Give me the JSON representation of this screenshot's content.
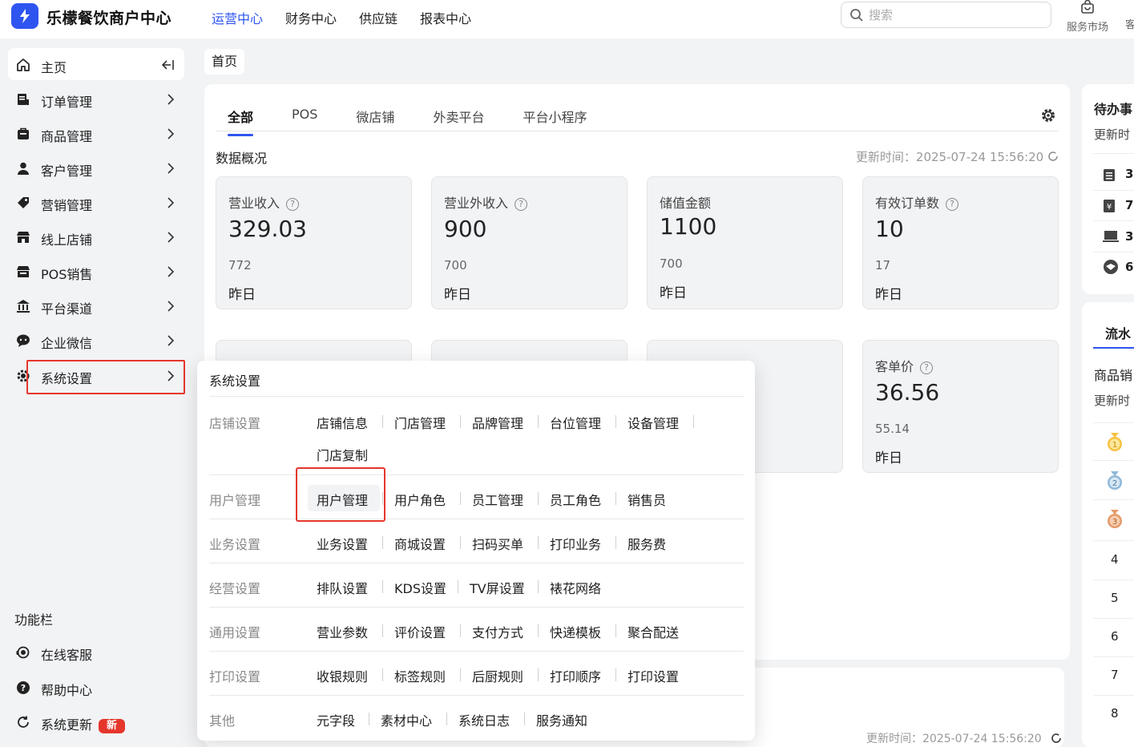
{
  "app": {
    "brand": "乐檬餐饮商户中心"
  },
  "topnav": [
    "运营中心",
    "财务中心",
    "供应链",
    "报表中心"
  ],
  "search": {
    "placeholder": "搜索"
  },
  "service_market": "服务市场",
  "customer_service_short": "客",
  "sidebar": {
    "items": [
      {
        "label": "主页",
        "icon": "home-icon"
      },
      {
        "label": "订单管理",
        "icon": "order-icon"
      },
      {
        "label": "商品管理",
        "icon": "product-icon"
      },
      {
        "label": "客户管理",
        "icon": "user-icon"
      },
      {
        "label": "营销管理",
        "icon": "tag-icon"
      },
      {
        "label": "线上店铺",
        "icon": "store-icon"
      },
      {
        "label": "POS销售",
        "icon": "pos-icon"
      },
      {
        "label": "平台渠道",
        "icon": "bank-icon"
      },
      {
        "label": "企业微信",
        "icon": "wechat-icon"
      },
      {
        "label": "系统设置",
        "icon": "gear-icon"
      }
    ],
    "function_title": "功能栏",
    "functions": [
      {
        "label": "在线客服",
        "icon": "headset-icon"
      },
      {
        "label": "帮助中心",
        "icon": "help-icon"
      },
      {
        "label": "系统更新",
        "icon": "refresh-icon",
        "badge": "新"
      }
    ]
  },
  "breadcrumb": "首页",
  "tabs": [
    "全部",
    "POS",
    "微店铺",
    "外卖平台",
    "平台小程序"
  ],
  "overview": {
    "title": "数据概况",
    "updated": "更新时间：2025-07-24 15:56:20",
    "cards": [
      {
        "title": "营业收入",
        "value": "329.03",
        "prev": "772",
        "yesterday": "昨日",
        "help": true
      },
      {
        "title": "营业外收入",
        "value": "900",
        "prev": "700",
        "yesterday": "昨日",
        "help": true
      },
      {
        "title": "储值金额",
        "value": "1100",
        "prev": "700",
        "yesterday": "昨日",
        "help": false
      },
      {
        "title": "有效订单数",
        "value": "10",
        "prev": "17",
        "yesterday": "昨日",
        "help": true
      },
      {
        "title": "客单价",
        "value": "36.56",
        "prev": "55.14",
        "yesterday": "昨日",
        "help": true
      }
    ]
  },
  "panel2": {
    "updated": "更新时间：2025-07-24 15:56:20"
  },
  "right": {
    "todo_title": "待办事",
    "todo_updated": "更新时",
    "todo_counts": [
      "3",
      "7",
      "3",
      "6"
    ],
    "flow_tab": "流水",
    "rank_title": "商品销",
    "rank_updated": "更新时",
    "ranks": [
      "1",
      "2",
      "3",
      "4",
      "5",
      "6",
      "7",
      "8"
    ]
  },
  "popup": {
    "title": "系统设置",
    "groups": [
      {
        "label": "店铺设置",
        "links": [
          "店铺信息",
          "门店管理",
          "品牌管理",
          "台位管理",
          "设备管理",
          "门店复制"
        ]
      },
      {
        "label": "用户管理",
        "links": [
          "用户管理",
          "用户角色",
          "员工管理",
          "员工角色",
          "销售员"
        ]
      },
      {
        "label": "业务设置",
        "links": [
          "业务设置",
          "商城设置",
          "扫码买单",
          "打印业务",
          "服务费"
        ]
      },
      {
        "label": "经营设置",
        "links": [
          "排队设置",
          "KDS设置",
          "TV屏设置",
          "裱花网络"
        ]
      },
      {
        "label": "通用设置",
        "links": [
          "营业参数",
          "评价设置",
          "支付方式",
          "快递模板",
          "聚合配送"
        ]
      },
      {
        "label": "打印设置",
        "links": [
          "收银规则",
          "标签规则",
          "后厨规则",
          "打印顺序",
          "打印设置"
        ]
      },
      {
        "label": "其他",
        "links": [
          "元字段",
          "素材中心",
          "系统日志",
          "服务通知"
        ]
      }
    ]
  },
  "colors": {
    "accent": "#2f55f0",
    "alert": "#e5362c",
    "bg": "#f2f3f5"
  }
}
